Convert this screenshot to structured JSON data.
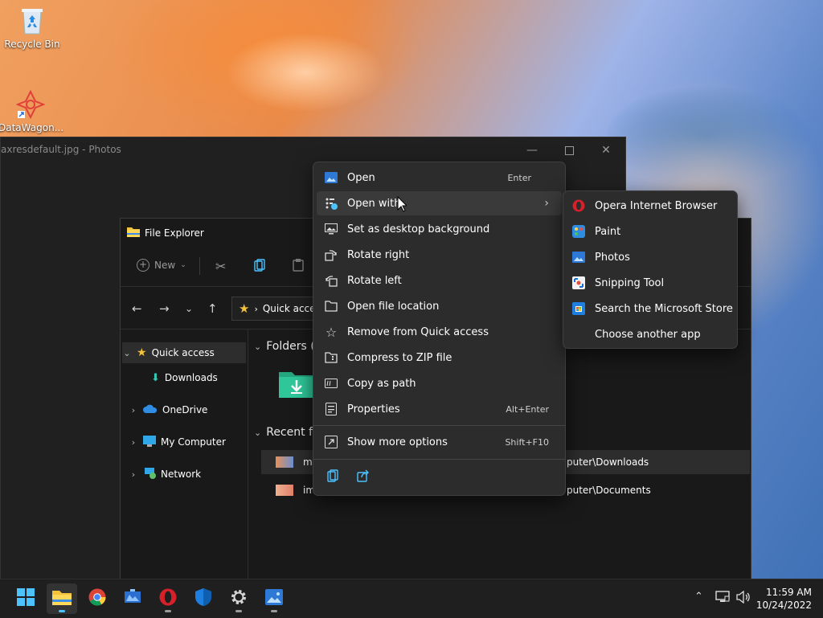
{
  "desktop": {
    "icons": [
      {
        "label": "Recycle Bin"
      },
      {
        "label": "DataWagon..."
      }
    ]
  },
  "photos": {
    "title": "axresdefault.jpg - Photos"
  },
  "explorer": {
    "title": "File Explorer",
    "new_label": "New",
    "address": "Quick access",
    "sidebar": [
      {
        "label": "Quick access"
      },
      {
        "label": "Downloads"
      },
      {
        "label": "OneDrive"
      },
      {
        "label": "My Computer"
      },
      {
        "label": "Network"
      }
    ],
    "folders_header": "Folders (",
    "recent_header": "Recent fi",
    "recent_rows": [
      {
        "name": "m",
        "location": "puter\\Downloads"
      },
      {
        "name": "im",
        "location": "puter\\Documents"
      }
    ]
  },
  "context_menu": {
    "items": [
      {
        "label": "Open",
        "shortcut": "Enter"
      },
      {
        "label": "Open with",
        "shortcut": ""
      },
      {
        "label": "Set as desktop background",
        "shortcut": ""
      },
      {
        "label": "Rotate right",
        "shortcut": ""
      },
      {
        "label": "Rotate left",
        "shortcut": ""
      },
      {
        "label": "Open file location",
        "shortcut": ""
      },
      {
        "label": "Remove from Quick access",
        "shortcut": ""
      },
      {
        "label": "Compress to ZIP file",
        "shortcut": ""
      },
      {
        "label": "Copy as path",
        "shortcut": ""
      },
      {
        "label": "Properties",
        "shortcut": "Alt+Enter"
      },
      {
        "label": "Show more options",
        "shortcut": "Shift+F10"
      }
    ]
  },
  "open_with_submenu": {
    "items": [
      {
        "label": "Opera Internet Browser"
      },
      {
        "label": "Paint"
      },
      {
        "label": "Photos"
      },
      {
        "label": "Snipping Tool"
      },
      {
        "label": "Search the Microsoft Store"
      },
      {
        "label": "Choose another app"
      }
    ]
  },
  "taskbar": {
    "time": "11:59 AM",
    "date": "10/24/2022"
  },
  "colors": {
    "menu_bg": "#2c2c2c",
    "accent": "#4cc2ff",
    "opera_red": "#d6202a",
    "folder_yellow": "#f4c33b"
  }
}
